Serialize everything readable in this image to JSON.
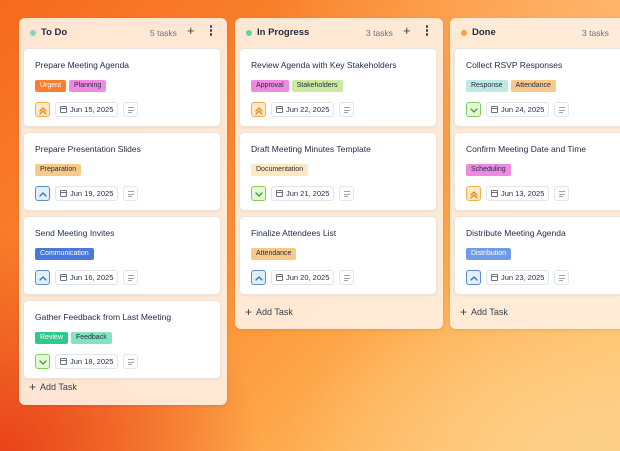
{
  "colors": {
    "todo": "#7ed9c4",
    "in_progress": "#5ed1a8",
    "done": "#f6a23c",
    "prio_high_bg": "#fde9c8",
    "prio_high_border": "#f3b04a",
    "prio_high_fg": "#e08a12",
    "prio_med_bg": "#dff0fb",
    "prio_med_border": "#5b8cc9",
    "prio_med_fg": "#3f6fb0",
    "prio_low_bg": "#e3f8d6",
    "prio_low_border": "#86cc5c",
    "prio_low_fg": "#4d9a2a"
  },
  "columns": [
    {
      "title": "To Do",
      "count": "5 tasks",
      "add_icon": "plus-icon",
      "more_icon": "more-vertical-icon",
      "add_task": "Add Task",
      "cards": [
        {
          "title": "Prepare Meeting Agenda",
          "priority": "high",
          "priority_icon": "chevrons-up-icon",
          "date": "Jun 15, 2025",
          "tags": [
            {
              "label": "Urgent",
              "bg": "#f97e2d",
              "fg": "#ffffff"
            },
            {
              "label": "Planning",
              "bg": "#ee8ae0",
              "fg": "#1f2a44"
            }
          ]
        },
        {
          "title": "Prepare Presentation Slides",
          "priority": "medium",
          "priority_icon": "chevron-up-icon",
          "date": "Jun 19, 2025",
          "tags": [
            {
              "label": "Preparation",
              "bg": "#f9c98a",
              "fg": "#1f2a44"
            }
          ]
        },
        {
          "title": "Send Meeting Invites",
          "priority": "medium",
          "priority_icon": "chevron-up-icon",
          "date": "Jun 16, 2025",
          "tags": [
            {
              "label": "Communication",
              "bg": "#4a78d9",
              "fg": "#ffffff"
            }
          ]
        },
        {
          "title": "Gather Feedback from Last Meeting",
          "priority": "low",
          "priority_icon": "chevron-down-icon",
          "date": "Jun 18, 2025",
          "tags": [
            {
              "label": "Review",
              "bg": "#2fca8a",
              "fg": "#ffffff"
            },
            {
              "label": "Feedback",
              "bg": "#86e3c2",
              "fg": "#1f2a44"
            }
          ]
        }
      ]
    },
    {
      "title": "In Progress",
      "count": "3 tasks",
      "add_icon": "plus-icon",
      "more_icon": "more-vertical-icon",
      "add_task": "Add Task",
      "cards": [
        {
          "title": "Review Agenda with Key Stakeholders",
          "priority": "high",
          "priority_icon": "chevrons-up-icon",
          "date": "Jun 22, 2025",
          "tags": [
            {
              "label": "Approval",
              "bg": "#ee8ae0",
              "fg": "#1f2a44"
            },
            {
              "label": "Stakeholders",
              "bg": "#cdeaa3",
              "fg": "#1f2a44"
            }
          ]
        },
        {
          "title": "Draft Meeting Minutes Template",
          "priority": "low",
          "priority_icon": "chevron-down-icon",
          "date": "Jun 21, 2025",
          "tags": [
            {
              "label": "Documentation",
              "bg": "#fde8c2",
              "fg": "#1f2a44"
            }
          ]
        },
        {
          "title": "Finalize Attendees List",
          "priority": "medium",
          "priority_icon": "chevron-up-icon",
          "date": "Jun 20, 2025",
          "tags": [
            {
              "label": "Attendance",
              "bg": "#f9c98a",
              "fg": "#1f2a44"
            }
          ]
        }
      ]
    },
    {
      "title": "Done",
      "count": "3 tasks",
      "add_task": "Add Task",
      "cards": [
        {
          "title": "Collect RSVP Responses",
          "priority": "low",
          "priority_icon": "chevron-down-icon",
          "date": "Jun 24, 2025",
          "tags": [
            {
              "label": "Response",
              "bg": "#bfe9e3",
              "fg": "#1f2a44"
            },
            {
              "label": "Attendance",
              "bg": "#f9c98a",
              "fg": "#1f2a44"
            }
          ]
        },
        {
          "title": "Confirm Meeting Date and Time",
          "priority": "high",
          "priority_icon": "chevrons-up-icon",
          "date": "Jun 13, 2025",
          "tags": [
            {
              "label": "Scheduling",
              "bg": "#ee8ae0",
              "fg": "#1f2a44"
            }
          ]
        },
        {
          "title": "Distribute Meeting Agenda",
          "priority": "medium",
          "priority_icon": "chevron-up-icon",
          "date": "Jun 23, 2025",
          "tags": [
            {
              "label": "Distribution",
              "bg": "#6f9ce8",
              "fg": "#ffffff"
            }
          ]
        }
      ]
    }
  ]
}
